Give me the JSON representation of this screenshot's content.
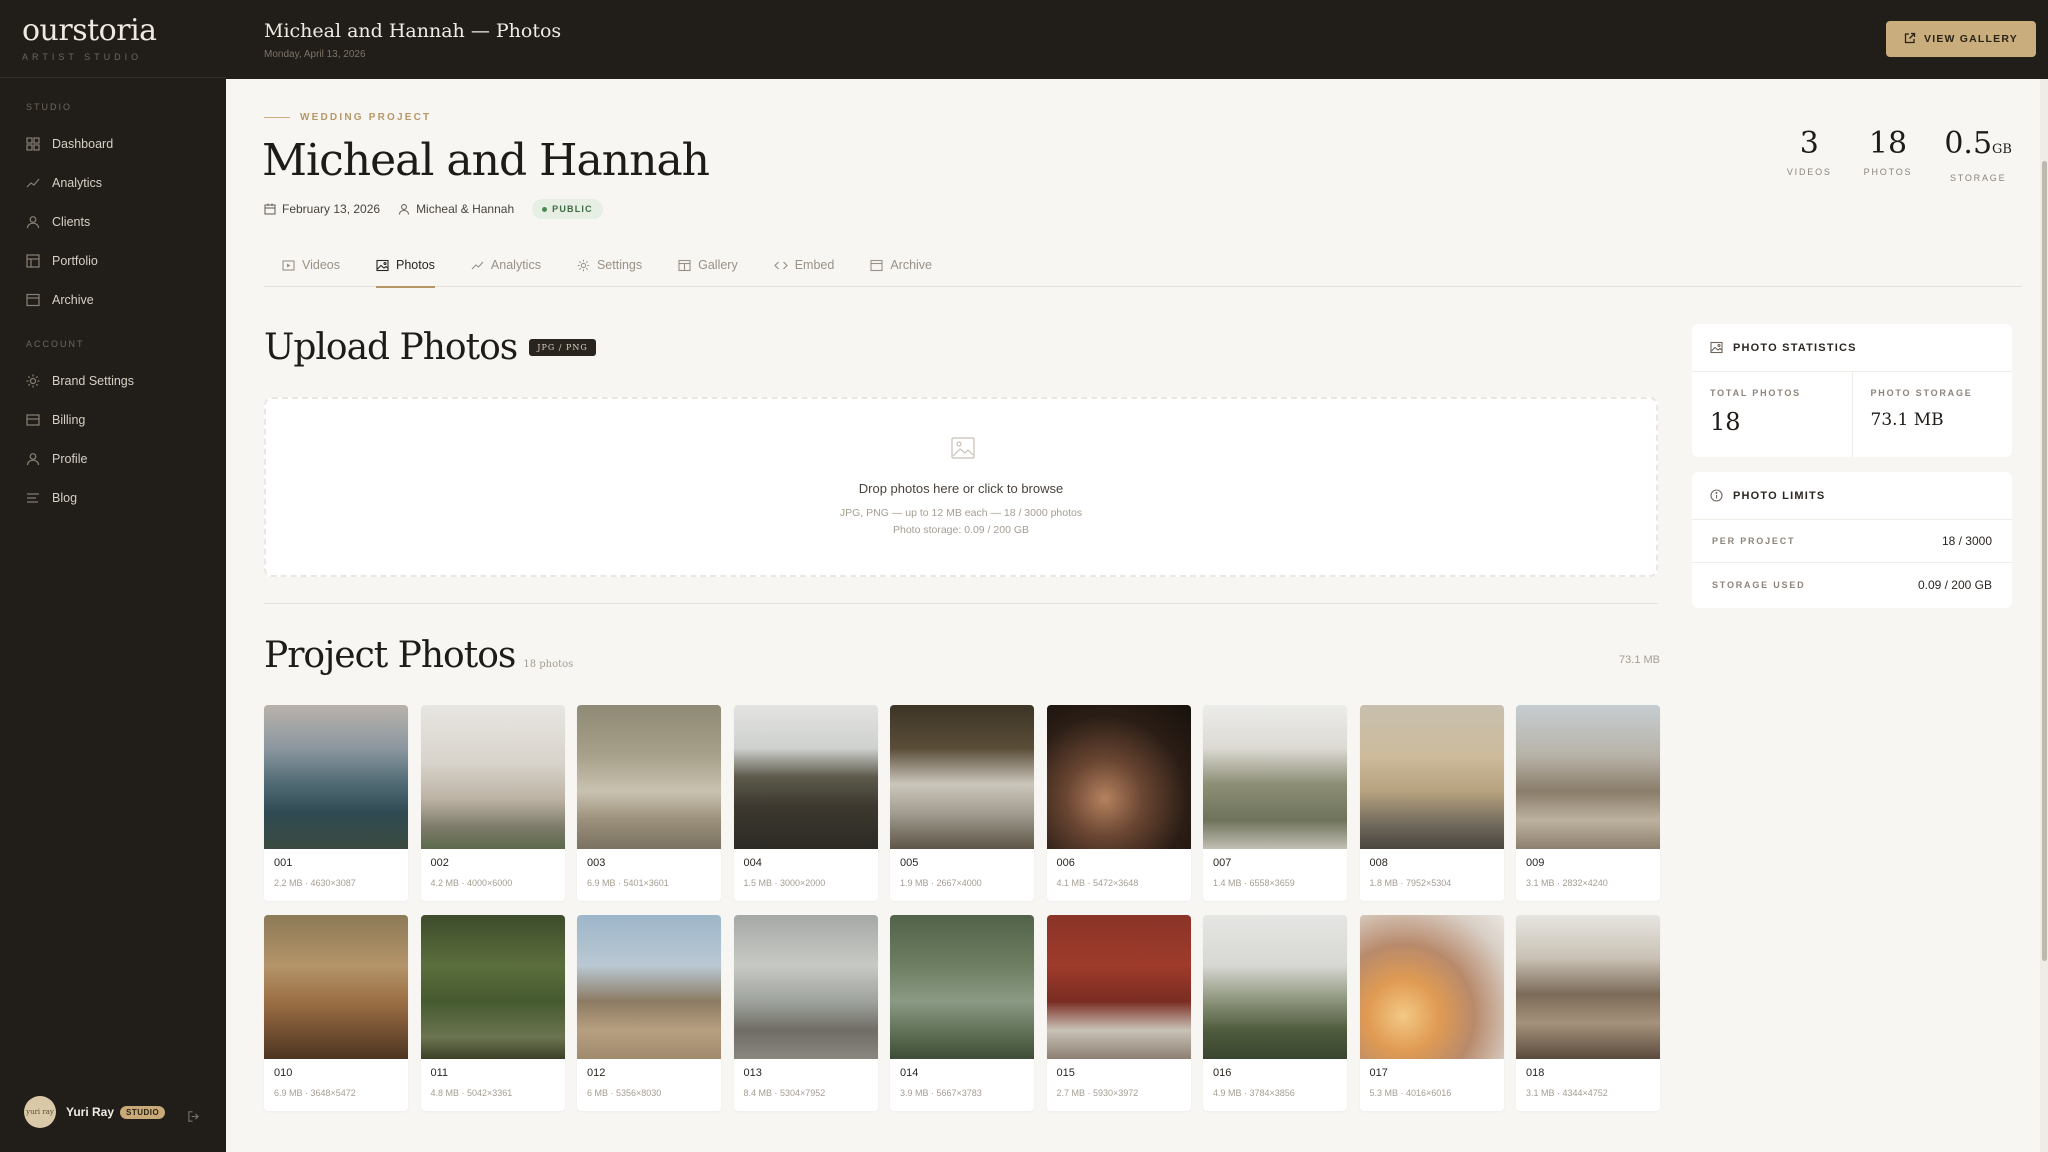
{
  "brand": {
    "logo": "ourstoria",
    "tagline": "ARTIST STUDIO"
  },
  "sidebar": {
    "studio_label": "STUDIO",
    "account_label": "ACCOUNT",
    "studio_items": [
      {
        "label": "Dashboard",
        "icon": "grid-icon"
      },
      {
        "label": "Analytics",
        "icon": "trend-icon"
      },
      {
        "label": "Clients",
        "icon": "user-icon"
      },
      {
        "label": "Portfolio",
        "icon": "layout-icon"
      },
      {
        "label": "Archive",
        "icon": "archive-icon"
      }
    ],
    "account_items": [
      {
        "label": "Brand Settings",
        "icon": "sun-icon"
      },
      {
        "label": "Billing",
        "icon": "card-icon"
      },
      {
        "label": "Profile",
        "icon": "user-icon"
      },
      {
        "label": "Blog",
        "icon": "lines-icon"
      }
    ],
    "user": {
      "name": "Yuri Ray",
      "badge": "STUDIO",
      "avatar_text": "yuri ray"
    }
  },
  "topbar": {
    "title": "Micheal and Hannah — Photos",
    "date": "Monday, April 13, 2026",
    "view_gallery": "VIEW GALLERY"
  },
  "project": {
    "eyebrow": "WEDDING PROJECT",
    "title": "Micheal and Hannah",
    "date": "February 13, 2026",
    "couple": "Micheal & Hannah",
    "visibility": "PUBLIC",
    "stats": [
      {
        "value": "3",
        "unit": "",
        "label": "VIDEOS"
      },
      {
        "value": "18",
        "unit": "",
        "label": "PHOTOS"
      },
      {
        "value": "0.5",
        "unit": "GB",
        "label": "STORAGE"
      }
    ]
  },
  "tabs": [
    {
      "label": "Videos",
      "icon": "video-icon",
      "active": false
    },
    {
      "label": "Photos",
      "icon": "image-icon",
      "active": true
    },
    {
      "label": "Analytics",
      "icon": "trend-icon",
      "active": false
    },
    {
      "label": "Settings",
      "icon": "sun-icon",
      "active": false
    },
    {
      "label": "Gallery",
      "icon": "gallery-icon",
      "active": false
    },
    {
      "label": "Embed",
      "icon": "code-icon",
      "active": false
    },
    {
      "label": "Archive",
      "icon": "archive-icon",
      "active": false
    }
  ],
  "upload": {
    "title": "Upload Photos",
    "formats": "JPG / PNG",
    "drop_main": "Drop photos here or click to browse",
    "drop_sub1": "JPG, PNG — up to 12 MB each — 18 / 3000 photos",
    "drop_sub2": "Photo storage: 0.09 / 200 GB"
  },
  "project_photos": {
    "title": "Project Photos",
    "count": "18 photos",
    "total_size": "73.1 MB",
    "photos": [
      {
        "n": "001",
        "meta": "2.2 MB · 4630×3087",
        "bg": "linear-gradient(180deg,#b9b2ac 0%,#8c97a0 30%,#4f6a73 55%,#2f4a52 75%,#3b4a40 100%)"
      },
      {
        "n": "002",
        "meta": "4.2 MB · 4000×6000",
        "bg": "linear-gradient(180deg,#e8e6e2 0%,#d8d3cb 40%,#bdb3a5 65%,#7d7a6a 85%,#5b6a4a 100%)"
      },
      {
        "n": "003",
        "meta": "6.9 MB · 5401×3601",
        "bg": "linear-gradient(180deg,#8f8a76 0%,#a7a08a 35%,#c9c2b1 60%,#9a8f7a 80%,#7b7262 100%)"
      },
      {
        "n": "004",
        "meta": "1.5 MB · 3000×2000",
        "bg": "linear-gradient(180deg,#e3e4e2 0%,#cfd1cf 30%,#5d5a4c 50%,#3d3930 70%,#2c2a24 100%)"
      },
      {
        "n": "005",
        "meta": "1.9 MB · 2667×4000",
        "bg": "linear-gradient(180deg,#3c3426 0%,#5a4d38 30%,#cbc6bc 55%,#a39c90 75%,#5c5548 100%)"
      },
      {
        "n": "006",
        "meta": "4.1 MB · 5472×3648",
        "bg": "radial-gradient(circle at 40% 65%,#b5825f 0%,#6a4632 30%,#2a1d15 65%,#17110c 100%)"
      },
      {
        "n": "007",
        "meta": "1.4 MB · 6558×3659",
        "bg": "linear-gradient(180deg,#ececea 0%,#dcdad3 30%,#8d8e76 55%,#6f735b 80%,#c2c0b5 100%)"
      },
      {
        "n": "008",
        "meta": "1.8 MB · 7952×5304",
        "bg": "linear-gradient(180deg,#c7bfae 0%,#cdbb9c 35%,#b7a27f 60%,#6b6458 85%,#4a463f 100%)"
      },
      {
        "n": "009",
        "meta": "3.1 MB · 2832×4240",
        "bg": "linear-gradient(180deg,#c6cdd1 0%,#b8b3a8 35%,#8a7d6a 60%,#bdb1a0 80%,#8d806e 100%)"
      },
      {
        "n": "010",
        "meta": "6.9 MB · 3648×5472",
        "bg": "linear-gradient(180deg,#8c7a57 0%,#b49469 35%,#9c6f45 60%,#6b4a2e 85%,#4c3520 100%)"
      },
      {
        "n": "011",
        "meta": "4.8 MB · 5042×3361",
        "bg": "linear-gradient(180deg,#3d4b2c 0%,#5b6e3c 35%,#465a30 60%,#6b7450 85%,#3a4027 100%)"
      },
      {
        "n": "012",
        "meta": "6 MB · 5356×8030",
        "bg": "linear-gradient(180deg,#9eb6c9 0%,#b9c8d3 35%,#8c7b63 60%,#b79f80 80%,#a08a6e 100%)"
      },
      {
        "n": "013",
        "meta": "8.4 MB · 5304×7952",
        "bg": "linear-gradient(180deg,#a5a9a6 0%,#c7c9c4 35%,#9fa39d 60%,#6f6d66 80%,#8a8680 100%)"
      },
      {
        "n": "014",
        "meta": "3.9 MB · 5667×3783",
        "bg": "linear-gradient(180deg,#52634a 0%,#6d7e62 35%,#8b9a84 60%,#596a50 85%,#3f4d38 100%)"
      },
      {
        "n": "015",
        "meta": "2.7 MB · 5930×3972",
        "bg": "linear-gradient(180deg,#8a3428 0%,#9e3b2b 35%,#7a2c22 60%,#c9c2b7 80%,#8c7f72 100%)"
      },
      {
        "n": "016",
        "meta": "4.9 MB · 3784×3856",
        "bg": "linear-gradient(180deg,#e6e6e4 0%,#d7d8d3 35%,#9aa18a 55%,#4f5b3d 80%,#3a4530 100%)"
      },
      {
        "n": "017",
        "meta": "5.3 MB · 4016×6016",
        "bg": "radial-gradient(circle at 30% 70%,#f3c985 0%,#e09b53 25%,#b88a6c 50%,#d9cfc5 80%,#eae6e1 100%)"
      },
      {
        "n": "018",
        "meta": "3.1 MB · 4344×4752",
        "bg": "linear-gradient(180deg,#e7e5e1 0%,#c9c1b4 30%,#7c6a58 55%,#a5927c 75%,#5a4a3c 100%)"
      }
    ]
  },
  "photo_stats": {
    "title": "PHOTO STATISTICS",
    "total_label": "TOTAL PHOTOS",
    "total_value": "18",
    "storage_label": "PHOTO STORAGE",
    "storage_value": "73.1 MB"
  },
  "photo_limits": {
    "title": "PHOTO LIMITS",
    "rows": [
      {
        "label": "PER PROJECT",
        "value": "18 / 3000"
      },
      {
        "label": "STORAGE USED",
        "value": "0.09 / 200 GB"
      }
    ]
  },
  "colors": {
    "accent": "#c9ad7c",
    "sidebar_bg": "#211d19",
    "page_bg": "#f7f6f3",
    "public_green": "#3f6b44"
  }
}
